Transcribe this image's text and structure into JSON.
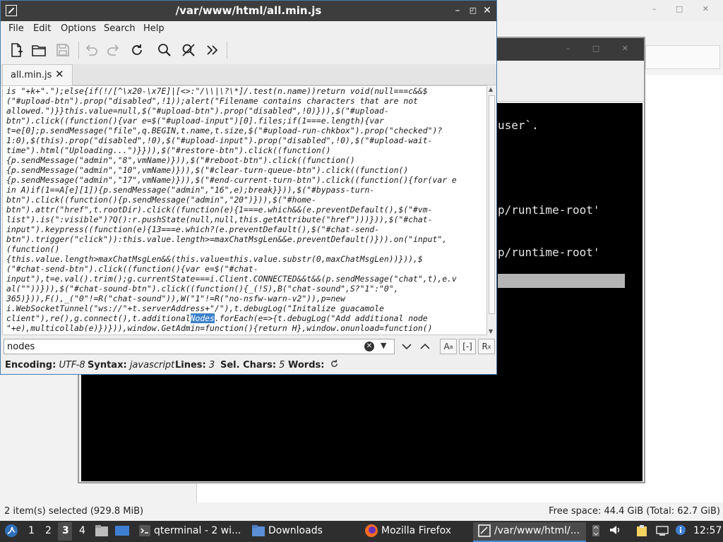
{
  "file_manager": {
    "status_left": "2 item(s) selected (929.8 MiB)",
    "status_right": "Free space: 44.4 GiB (Total: 62.7 GiB)",
    "window_controls": "– □ ✕"
  },
  "terminal": {
    "window_controls": "– □ ✕",
    "lines": [
      {
        "text": "user`.",
        "row": 0
      },
      {
        "text": "p/runtime-root'",
        "row": 1
      },
      {
        "text": "p/runtime-root'",
        "row": 2
      }
    ]
  },
  "editor": {
    "title": "/var/www/html/all.min.js",
    "menu": [
      "File",
      "Edit",
      "Options",
      "Search",
      "Help"
    ],
    "toolbar": [
      "new-file-icon",
      "open-folder-icon",
      "save-icon",
      "undo-icon",
      "redo-icon",
      "reload-icon",
      "search-icon",
      "replace-icon",
      "more-icon"
    ],
    "tab_label": "all.min.js",
    "code_before": "is \"+k+\".\");else{if(!/[^\\x20-\\x7E]|[<>:\"/\\\\|\\?\\*]/.test(n.name))return void(null===c&&$\n(\"#upload-btn\").prop(\"disabled\",!1));alert(\"Filename contains characters that are not\nallowed.\")}}this.value=null,$(\"#upload-btn\").prop(\"disabled\",!0)})),$(\"#upload-\nbtn\").click((function(){var e=$(\"#upload-input\")[0].files;if(1===e.length){var\nt=e[0];p.sendMessage(\"file\",q.BEGIN,t.name,t.size,$(\"#upload-run-chkbox\").prop(\"checked\")?\n1:0),$(this).prop(\"disabled\",!0),$(\"#upload-input\").prop(\"disabled\",!0),$(\"#upload-wait-\ntime\").html(\"Uploading...\")}})),$(\"#restore-btn\").click((function()\n{p.sendMessage(\"admin\",\"8\",vmName)})),$(\"#reboot-btn\").click((function()\n{p.sendMessage(\"admin\",\"10\",vmName)})),$(\"#clear-turn-queue-btn\").click((function()\n{p.sendMessage(\"admin\",\"17\",vmName)})),$(\"#end-current-turn-btn\").click((function(){for(var e\nin A)if(1==A[e][1]){p.sendMessage(\"admin\",\"16\",e);break}})),$(\"#bypass-turn-\nbtn\").click((function(){p.sendMessage(\"admin\",\"20\")})),$(\"#home-\nbtn\").attr(\"href\",t.rootDir).click((function(e){1===e.which&&(e.preventDefault(),$(\"#vm-\nlist\").is(\":visible\")?Q():r.pushState(null,null,this.getAttribute(\"href\")))})),$(\"#chat-\ninput\").keypress((function(e){13===e.which?(e.preventDefault(),$(\"#chat-send-\nbtn\").trigger(\"click\")):this.value.length>=maxChatMsgLen&&e.preventDefault()})).on(\"input\",\n(function()\n{this.value.length>maxChatMsgLen&&(this.value=this.value.substr(0,maxChatMsgLen))})),$\n(\"#chat-send-btn\").click((function(){var e=$(\"#chat-\ninput\"),t=e.val().trim();g.currentState===i.Client.CONNECTED&&t&&(p.sendMessage(\"chat\",t),e.v\nal(\"\"))})),$(\"#chat-sound-btn\").click((function(){_(!S),B(\"chat-sound\",S?\"1\":\"0\",\n365)})),F(),_(\"0\"!=R(\"chat-sound\")),W(\"1\"!=R(\"no-nsfw-warn-v2\")),p=new\ni.WebSocketTunnel(\"ws://\"+t.serverAddress+\"/\"),t.debugLog(\"Initalize guacamole\nclient\"),re(),g.connect(),t.additional",
    "code_highlight": "Nodes",
    "code_after": ".forEach(e=>{t.debugLog(\"Add additional node\n\"+e),multicollab(e)})})),window.GetAdmin=function(){return H},window.onunload=function()",
    "find_value": "nodes",
    "find_options": [
      "case-sensitive-icon",
      "whole-word-icon",
      "regex-icon"
    ],
    "status": {
      "encoding_label": "Encoding:",
      "encoding_value": "UTF-8",
      "syntax_label": "Syntax:",
      "syntax_value": "javascript",
      "lines_label": "Lines:",
      "lines_value": "3",
      "selchars_label": "Sel. Chars:",
      "selchars_value": "5",
      "words_label": "Words:"
    }
  },
  "taskbar": {
    "workspaces": [
      "1",
      "2",
      "3",
      "4"
    ],
    "active_workspace": "3",
    "tasks": [
      {
        "label": "qterminal - 2 wi...",
        "icon": "terminal-icon"
      },
      {
        "label": "Downloads",
        "icon": "folder-icon"
      },
      {
        "label": "Mozilla Firefox",
        "icon": "firefox-icon"
      },
      {
        "label": "/var/www/html/...",
        "icon": "editor-icon"
      }
    ],
    "clock": "12:57"
  },
  "colors": {
    "accent": "#3b80c9",
    "titlebar": "#3d3d3d",
    "taskbar": "#2e2e2e"
  }
}
